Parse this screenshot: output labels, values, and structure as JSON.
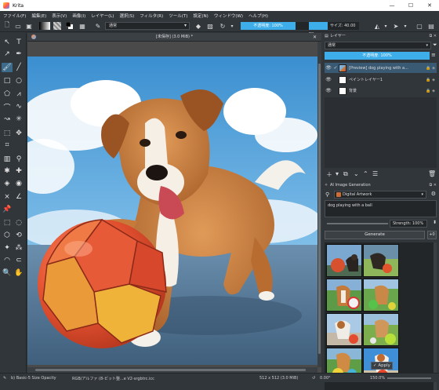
{
  "window": {
    "title": "Krita",
    "min": "—",
    "max": "☐",
    "close": "✕"
  },
  "menu": [
    "ファイル(F)",
    "編集(E)",
    "表示(V)",
    "画像(I)",
    "レイヤー(L)",
    "選択(S)",
    "フィルタ(R)",
    "ツール(T)",
    "設定(N)",
    "ウィンドウ(W)",
    "ヘルプ(H)"
  ],
  "toolbar": {
    "blend_mode": "通常",
    "opacity": "不透明度: 100%",
    "size": "サイズ: 40.00 px"
  },
  "document": {
    "tab_title": "[未保存] (3.0 MiB) *"
  },
  "layers_panel": {
    "title": "レイヤー",
    "blend_mode": "通常",
    "opacity": "不透明度: 100%",
    "layers": [
      {
        "name": "[Preview] dog playing with a...",
        "visible": true,
        "selected": true,
        "thumb": "dog"
      },
      {
        "name": "ペイントレイヤー1",
        "visible": true,
        "selected": false,
        "thumb": "white"
      },
      {
        "name": "背景",
        "visible": true,
        "selected": false,
        "thumb": "white"
      }
    ]
  },
  "ai_panel": {
    "title": "AI Image Generation",
    "model": "Digital Artwork",
    "prompt": "dog playing with a ball",
    "strength": "Strength: 100%",
    "generate_label": "Generate",
    "add_label": "+0",
    "apply_label": "✓ Apply"
  },
  "status": {
    "brush": "b) Basic-5 Size Opacity",
    "color_model": "RGB/アルファ (8-ビット整...e V2-srgbtrc.icc",
    "dimensions": "512 x 512 (3.0 MiB)",
    "rotation": "0.00°",
    "zoom": "150.0%"
  },
  "colors": {
    "accent": "#3daee9",
    "panel_bg": "#31363b",
    "ball_red": "#e25a3a",
    "ball_yellow": "#f0b33a",
    "sky": "#4f9fd8",
    "dog_fur": "#c8783a"
  }
}
